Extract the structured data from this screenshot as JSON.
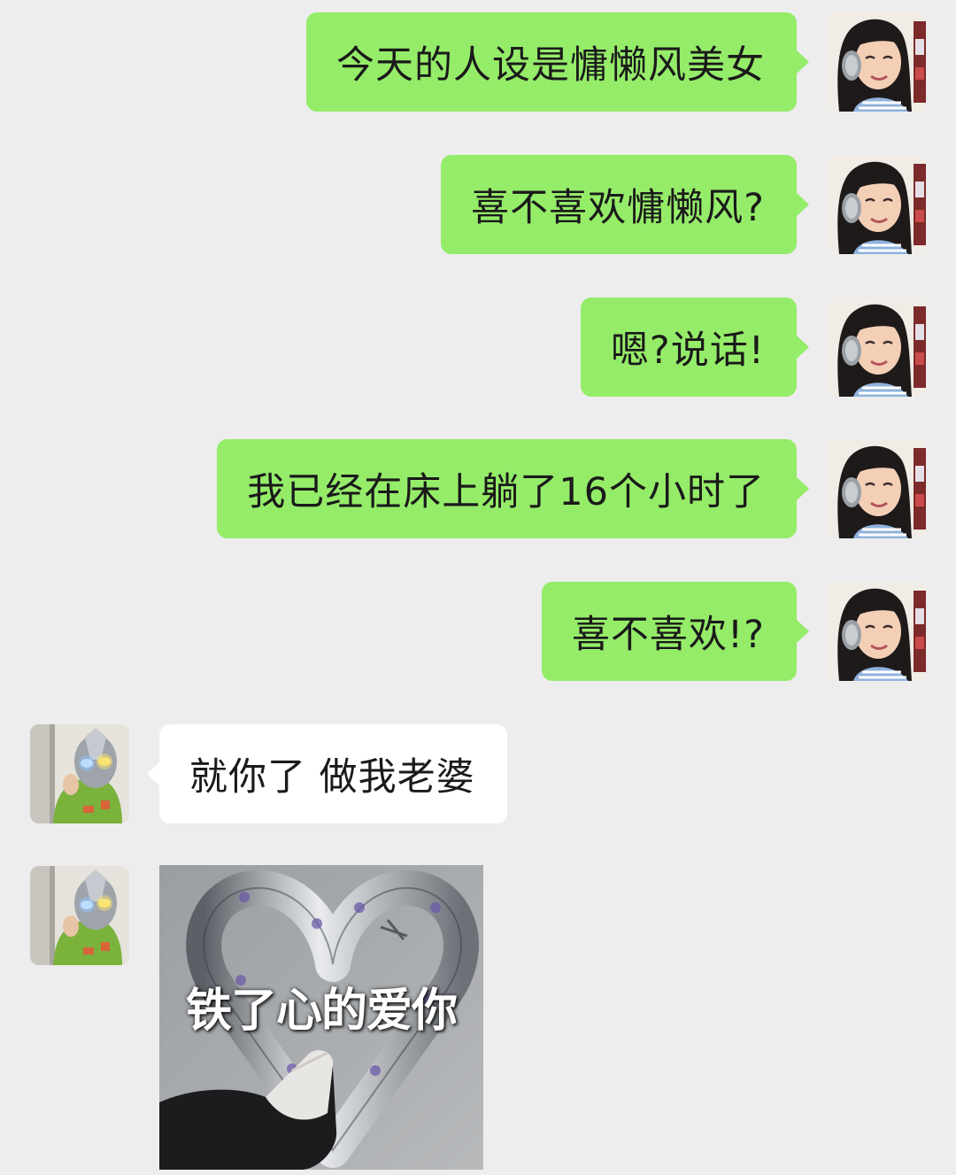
{
  "messages": [
    {
      "side": "out",
      "text": "今天的人设是慵懒风美女"
    },
    {
      "side": "out",
      "text": "喜不喜欢慵懒风?"
    },
    {
      "side": "out",
      "text": "嗯?说话!"
    },
    {
      "side": "out",
      "text": "我已经在床上躺了16个小时了"
    },
    {
      "side": "out",
      "text": "喜不喜欢!?"
    },
    {
      "side": "in",
      "text": "就你了 做我老婆"
    },
    {
      "side": "in",
      "type": "sticker",
      "caption": "铁了心的爱你"
    }
  ],
  "colors": {
    "background": "#ededed",
    "outgoing_bubble": "#95ec69",
    "incoming_bubble": "#ffffff"
  },
  "avatars": {
    "me": "girl-with-headphones-photo",
    "other": "ultraman-mask-photo"
  }
}
